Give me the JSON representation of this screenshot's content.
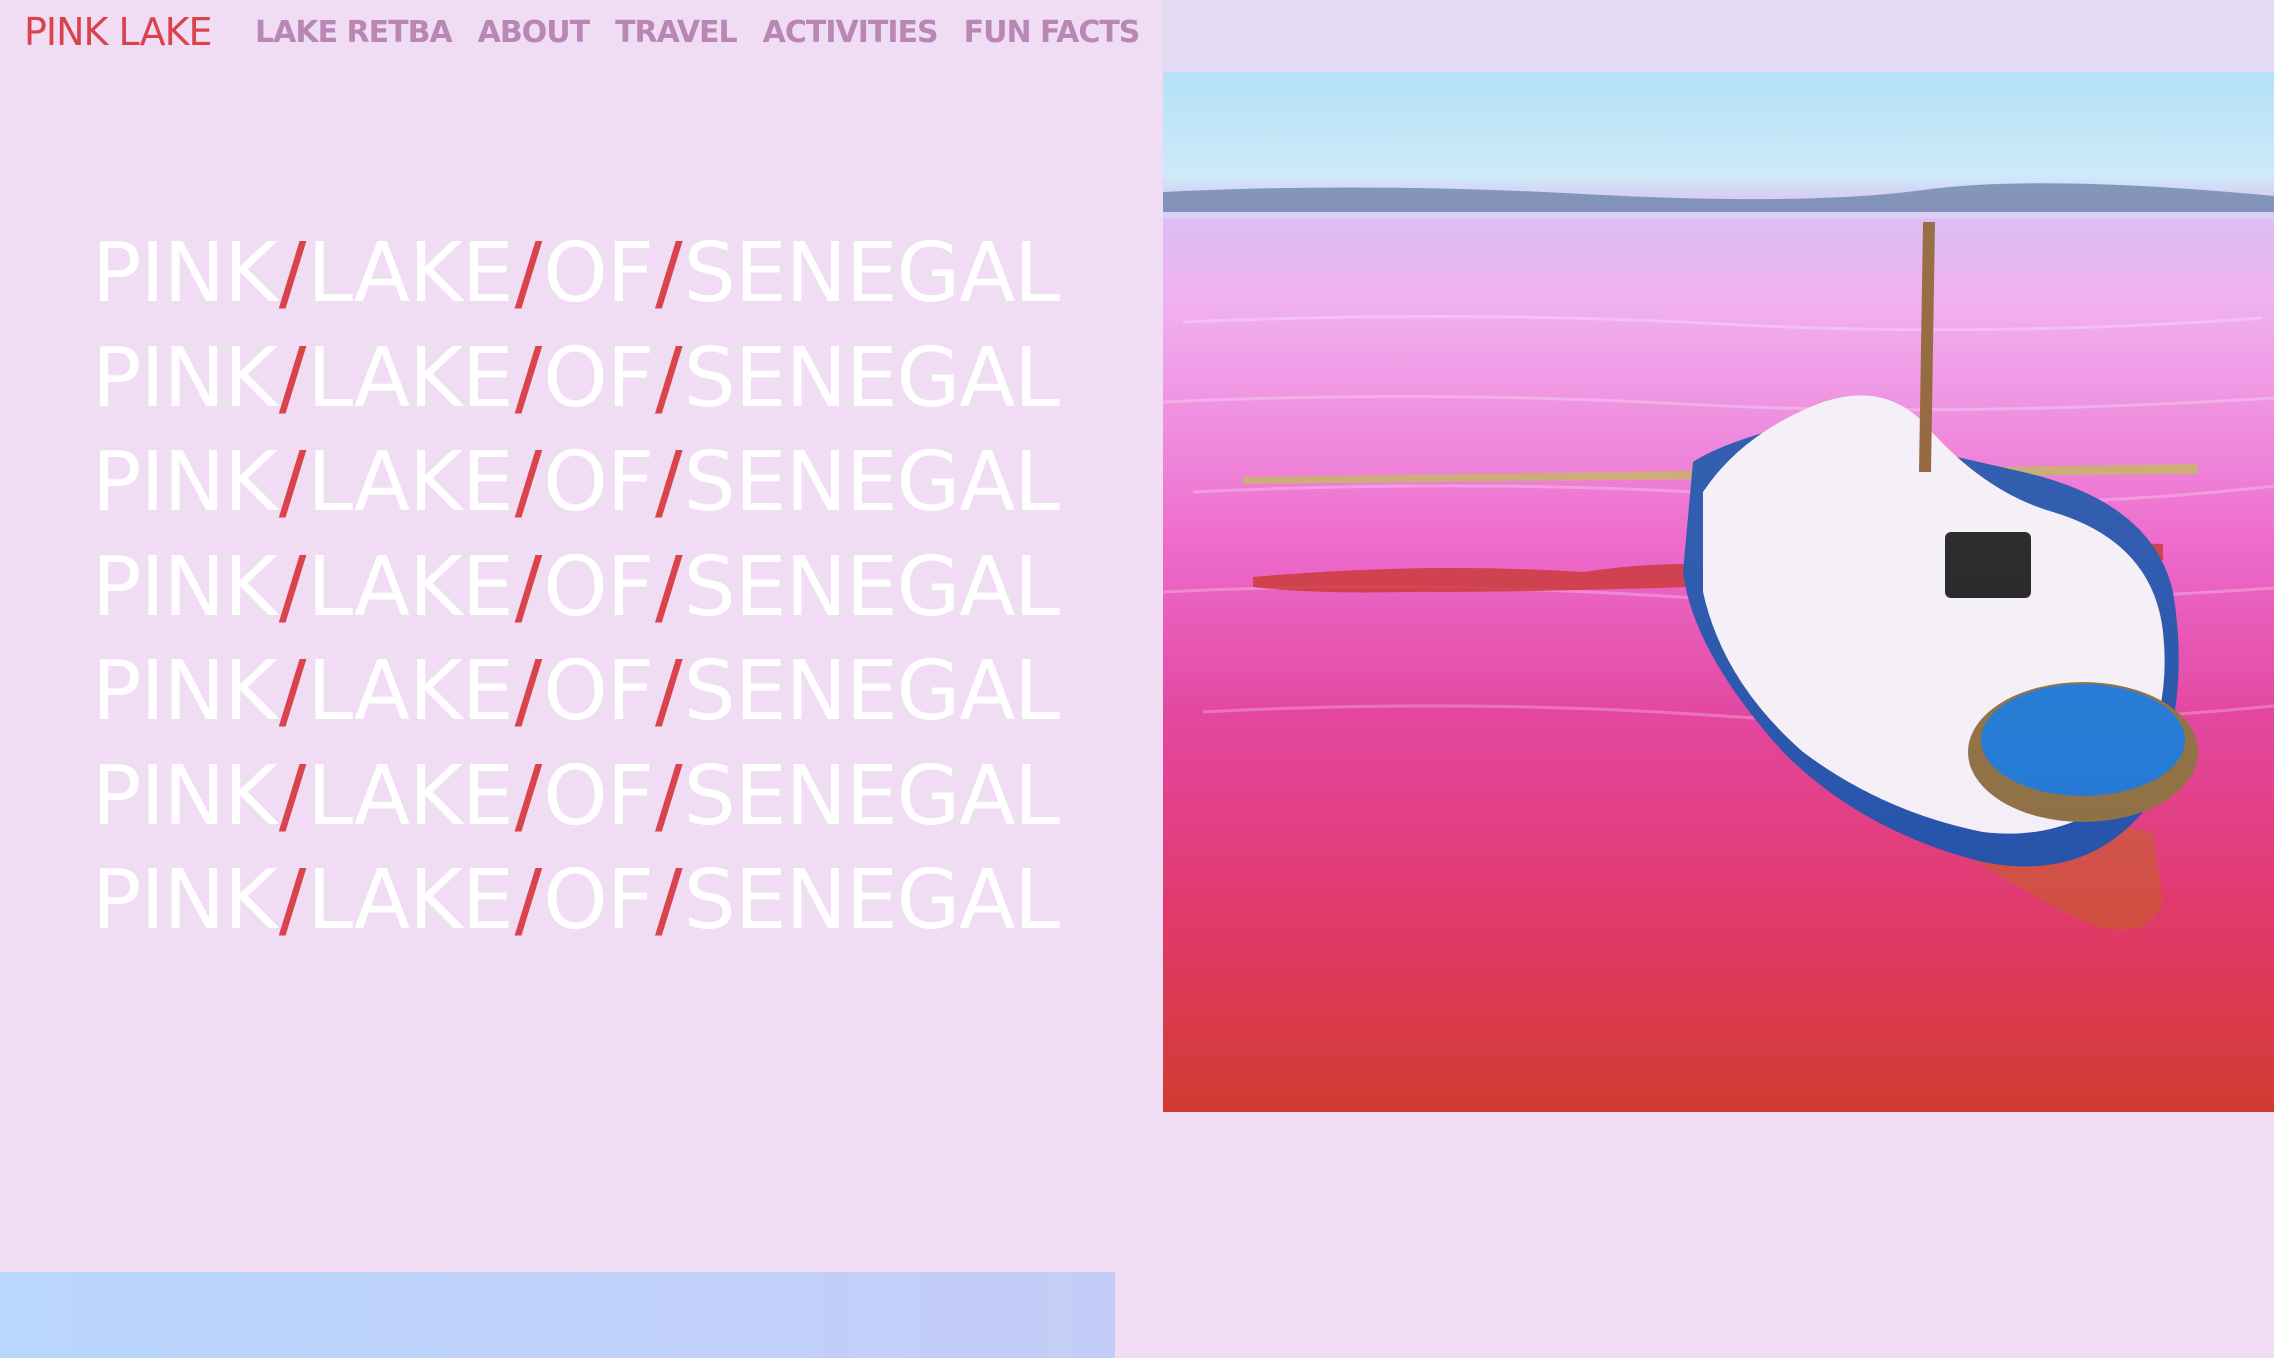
{
  "nav": {
    "brand": "PINK LAKE",
    "links": [
      {
        "label": "LAKE RETBA"
      },
      {
        "label": "ABOUT"
      },
      {
        "label": "TRAVEL"
      },
      {
        "label": "ACTIVITIES"
      },
      {
        "label": "FUN FACTS"
      }
    ]
  },
  "headline": {
    "words": [
      "PINK",
      "LAKE",
      "OF",
      "SENEGAL"
    ],
    "separator": "/",
    "repeat_count": 7
  },
  "hero_image": {
    "subject": "boat loaded with salt on pink lake"
  },
  "colors": {
    "background": "#f0dcf3",
    "accent": "#d9434b",
    "nav_link": "#b987b6",
    "headline_text": "#ffffff"
  }
}
